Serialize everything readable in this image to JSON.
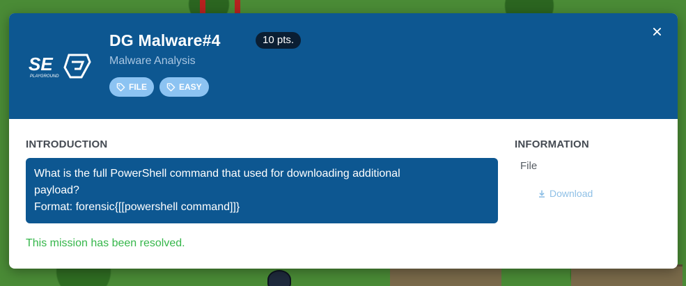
{
  "challenge": {
    "logo_text": "SEG",
    "logo_subtext": "PLAYGROUND",
    "title": "DG Malware#4",
    "points": "10 pts.",
    "category": "Malware Analysis",
    "tags": [
      "FILE",
      "EASY"
    ]
  },
  "introduction": {
    "heading": "INTRODUCTION",
    "lines": [
      "What is the full PowerShell command that used for downloading additional",
      "payload?",
      "Format: forensic{[[powershell command]]}"
    ]
  },
  "status": {
    "message": "This mission has been resolved."
  },
  "information": {
    "heading": "INFORMATION",
    "file_label": "File",
    "download_label": "Download"
  },
  "icons": {
    "close": "close-icon",
    "tag": "tag-icon",
    "download": "download-icon"
  },
  "colors": {
    "header_bg": "#0d5791",
    "tag_bg": "#8cc3f2",
    "resolved": "#35b64a",
    "download": "#8fc0e6"
  }
}
